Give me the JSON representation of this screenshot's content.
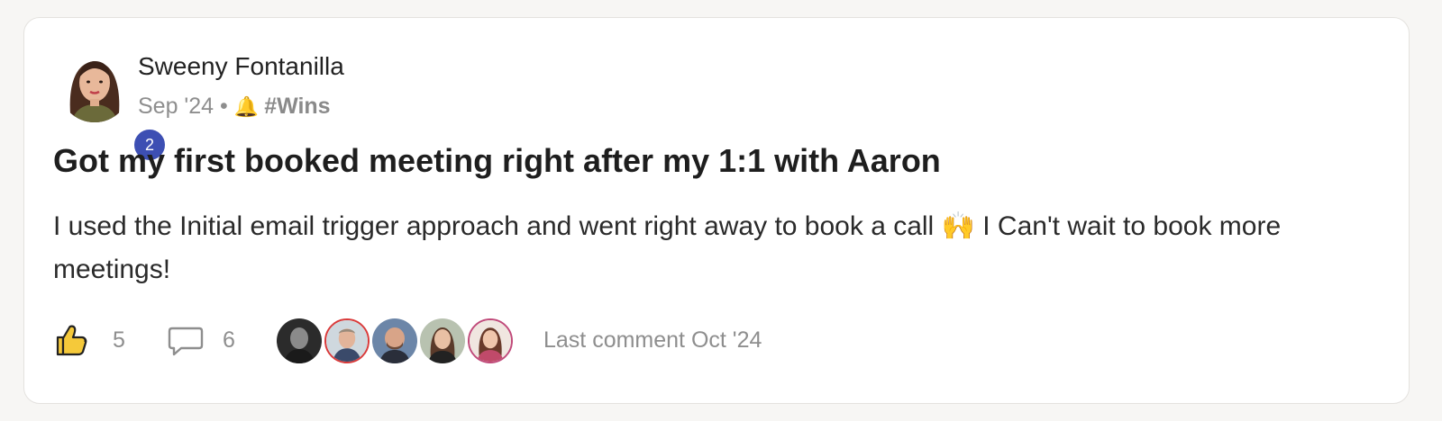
{
  "post": {
    "author": {
      "name": "Sweeny Fontanilla",
      "level": "2"
    },
    "meta": {
      "date": "Sep '24",
      "separator": "•",
      "category_icon": "bell-icon",
      "category": "#Wins"
    },
    "title": "Got my first booked meeting right after my 1:1 with Aaron",
    "body": "I used the Initial email trigger approach and went right away to book a call 🙌 I Can't wait to book more meetings!",
    "stats": {
      "likes": "5",
      "comments": "6"
    },
    "participants": [
      {
        "avatar": "participant-1-avatar"
      },
      {
        "avatar": "participant-2-avatar",
        "ring_color": "#d93a3a"
      },
      {
        "avatar": "participant-3-avatar"
      },
      {
        "avatar": "participant-4-avatar"
      },
      {
        "avatar": "participant-5-avatar",
        "ring_color": "#c04a7a"
      }
    ],
    "last_comment": "Last comment Oct '24"
  },
  "colors": {
    "level_badge": "#3d4fb3",
    "muted_text": "#8e8e8e",
    "card_background": "#ffffff",
    "page_background": "#f7f6f4"
  }
}
